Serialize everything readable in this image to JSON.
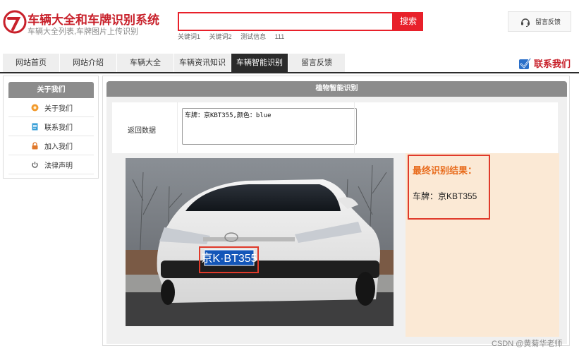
{
  "header": {
    "site_title": "车辆大全和车牌识别系统",
    "site_subtitle": "车辆大全列表,车牌图片上传识别",
    "search": {
      "value": "",
      "button_label": "搜索"
    },
    "hot_keywords": [
      "关键词1",
      "关键词2",
      "测试信息",
      "111"
    ],
    "feedback_label": "留言反馈"
  },
  "nav": {
    "items": [
      {
        "label": "网站首页"
      },
      {
        "label": "网站介绍"
      },
      {
        "label": "车辆大全"
      },
      {
        "label": "车辆资讯知识"
      },
      {
        "label": "车辆智能识别"
      },
      {
        "label": "留言反馈"
      }
    ],
    "active_index": 4,
    "contact_label": "联系我们"
  },
  "sidebar": {
    "title": "关于我们",
    "items": [
      {
        "label": "关于我们",
        "icon": "orange-circle-icon"
      },
      {
        "label": "联系我们",
        "icon": "document-icon"
      },
      {
        "label": "加入我们",
        "icon": "lock-icon"
      },
      {
        "label": "法律声明",
        "icon": "power-icon"
      }
    ]
  },
  "main": {
    "title": "植物智能识别",
    "form": {
      "label": "返回数据",
      "value": "车牌：京KBT355,颜色：blue"
    },
    "plate_text": "京K·BT355",
    "result": {
      "title": "最终识别结果：",
      "text": "车牌：京KBT355"
    }
  },
  "watermark": "CSDN @黄菊华老师",
  "colors": {
    "brand_red": "#c8202a",
    "search_red": "#e8202a",
    "nav_active": "#2b2b2b",
    "panel_header": "#8c8c8c",
    "result_bg": "#fbe9d5",
    "result_title": "#e86a1a"
  }
}
